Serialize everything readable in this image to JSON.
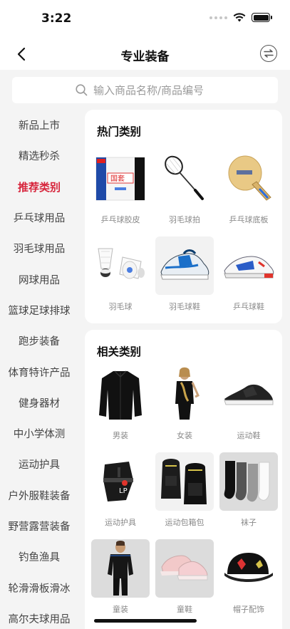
{
  "status_bar": {
    "time": "3:22"
  },
  "nav": {
    "title": "专业装备"
  },
  "search": {
    "placeholder": "输入商品名称/商品编号"
  },
  "sidebar": {
    "active_index": 2,
    "items": [
      {
        "label": "新品上市"
      },
      {
        "label": "精选秒杀"
      },
      {
        "label": "推荐类别"
      },
      {
        "label": "乒乓球用品"
      },
      {
        "label": "羽毛球用品"
      },
      {
        "label": "网球用品"
      },
      {
        "label": "篮球足球排球"
      },
      {
        "label": "跑步装备"
      },
      {
        "label": "体育特许产品"
      },
      {
        "label": "健身器材"
      },
      {
        "label": "中小学体测"
      },
      {
        "label": "运动护具"
      },
      {
        "label": "户外服鞋装备"
      },
      {
        "label": "野营露营装备"
      },
      {
        "label": "钓鱼渔具"
      },
      {
        "label": "轮滑滑板滑冰"
      },
      {
        "label": "高尔夫球用品"
      }
    ]
  },
  "hot": {
    "title": "热门类别",
    "items": [
      {
        "label": "乒乓球胶皮",
        "icon": "rubber-sheet-icon"
      },
      {
        "label": "羽毛球拍",
        "icon": "badminton-racket-icon"
      },
      {
        "label": "乒乓球底板",
        "icon": "ping-pong-blade-icon"
      },
      {
        "label": "羽毛球",
        "icon": "shuttlecock-icon"
      },
      {
        "label": "羽毛球鞋",
        "icon": "badminton-shoe-icon"
      },
      {
        "label": "乒乓球鞋",
        "icon": "ping-pong-shoe-icon"
      }
    ],
    "rubber_brand": "国套"
  },
  "related": {
    "title": "相关类别",
    "items": [
      {
        "label": "男装",
        "icon": "jacket-icon"
      },
      {
        "label": "女装",
        "icon": "dress-icon"
      },
      {
        "label": "运动鞋",
        "icon": "sneaker-icon"
      },
      {
        "label": "运动护具",
        "icon": "knee-brace-icon"
      },
      {
        "label": "运动包箱包",
        "icon": "backpack-icon"
      },
      {
        "label": "袜子",
        "icon": "socks-icon"
      },
      {
        "label": "童装",
        "icon": "kids-wear-icon"
      },
      {
        "label": "童鞋",
        "icon": "kids-shoe-icon"
      },
      {
        "label": "帽子配饰",
        "icon": "cap-icon"
      }
    ]
  },
  "colors": {
    "accent": "#d7263d",
    "background": "#f4f4f4",
    "card": "#ffffff"
  }
}
